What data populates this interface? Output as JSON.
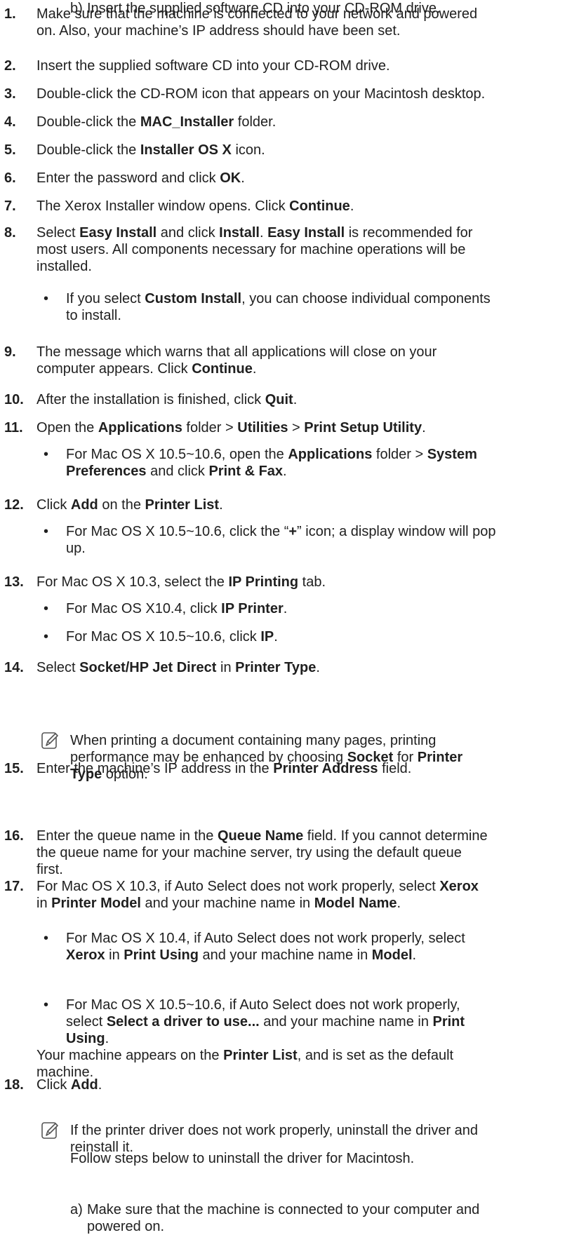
{
  "steps": [
    {
      "num": "1.",
      "lines": [
        [
          {
            "t": "Make sure that the machine is connected to your network and powered"
          }
        ],
        [
          {
            "t": "on. Also, your machine’s IP address should have been set."
          }
        ]
      ]
    },
    {
      "num": "2.",
      "lines": [
        [
          {
            "t": "Insert the supplied software CD into your CD-ROM drive."
          }
        ]
      ]
    },
    {
      "num": "3.",
      "lines": [
        [
          {
            "t": "Double-click the CD-ROM icon that appears on your Macintosh desktop."
          }
        ]
      ]
    },
    {
      "num": "4.",
      "lines": [
        [
          {
            "t": "Double-click the "
          },
          {
            "t": "MAC_Installer",
            "b": true
          },
          {
            "t": " folder."
          }
        ]
      ]
    },
    {
      "num": "5.",
      "lines": [
        [
          {
            "t": "Double-click the "
          },
          {
            "t": "Installer OS X",
            "b": true
          },
          {
            "t": " icon."
          }
        ]
      ]
    },
    {
      "num": "6.",
      "lines": [
        [
          {
            "t": "Enter the password and click "
          },
          {
            "t": "OK",
            "b": true
          },
          {
            "t": "."
          }
        ]
      ]
    },
    {
      "num": "7.",
      "lines": [
        [
          {
            "t": "The Xerox Installer window opens. Click "
          },
          {
            "t": "Continue",
            "b": true
          },
          {
            "t": "."
          }
        ]
      ]
    },
    {
      "num": "8.",
      "lines": [
        [
          {
            "t": "Select "
          },
          {
            "t": "Easy Install",
            "b": true
          },
          {
            "t": " and click "
          },
          {
            "t": "Install",
            "b": true
          },
          {
            "t": ". "
          },
          {
            "t": "Easy Install",
            "b": true
          },
          {
            "t": " is recommended for"
          }
        ],
        [
          {
            "t": "most users. All components necessary for machine operations will be"
          }
        ],
        [
          {
            "t": "installed."
          }
        ]
      ]
    },
    {
      "bullet": "•",
      "lines": [
        [
          {
            "t": "If you select "
          },
          {
            "t": "Custom Install",
            "b": true
          },
          {
            "t": ", you can choose individual components"
          }
        ],
        [
          {
            "t": "to install."
          }
        ]
      ]
    },
    {
      "num": "9.",
      "lines": [
        [
          {
            "t": "The message which warns that all applications will close on your"
          }
        ],
        [
          {
            "t": "computer appears. Click "
          },
          {
            "t": "Continue",
            "b": true
          },
          {
            "t": "."
          }
        ]
      ]
    },
    {
      "num": "10.",
      "lines": [
        [
          {
            "t": "After the installation is finished, click "
          },
          {
            "t": "Quit",
            "b": true
          },
          {
            "t": "."
          }
        ]
      ]
    },
    {
      "num": "11.",
      "lines": [
        [
          {
            "t": "Open the "
          },
          {
            "t": "Applications",
            "b": true
          },
          {
            "t": " folder > "
          },
          {
            "t": "Utilities",
            "b": true
          },
          {
            "t": " > "
          },
          {
            "t": "Print Setup Utility",
            "b": true
          },
          {
            "t": "."
          }
        ]
      ]
    },
    {
      "bullet": "•",
      "lines": [
        [
          {
            "t": "For Mac OS X 10.5~10.6, open the "
          },
          {
            "t": "Applications",
            "b": true
          },
          {
            "t": " folder > "
          },
          {
            "t": "System",
            "b": true
          }
        ],
        [
          {
            "t": "Preferences",
            "b": true
          },
          {
            "t": " and click "
          },
          {
            "t": "Print & Fax",
            "b": true
          },
          {
            "t": "."
          }
        ]
      ]
    },
    {
      "num": "12.",
      "lines": [
        [
          {
            "t": "Click "
          },
          {
            "t": "Add",
            "b": true
          },
          {
            "t": " on the "
          },
          {
            "t": "Printer List",
            "b": true
          },
          {
            "t": "."
          }
        ]
      ]
    },
    {
      "bullet": "•",
      "lines": [
        [
          {
            "t": "For Mac OS X 10.5~10.6, click the “"
          },
          {
            "t": "+",
            "b": true
          },
          {
            "t": "” icon; a display window will pop"
          }
        ],
        [
          {
            "t": "up."
          }
        ]
      ]
    },
    {
      "num": "13.",
      "lines": [
        [
          {
            "t": "For Mac OS X 10.3, select the "
          },
          {
            "t": "IP Printing",
            "b": true
          },
          {
            "t": " tab."
          }
        ]
      ]
    },
    {
      "bullet": "•",
      "lines": [
        [
          {
            "t": "For Mac OS X10.4, click "
          },
          {
            "t": "IP Printer",
            "b": true
          },
          {
            "t": "."
          }
        ]
      ]
    },
    {
      "bullet": "•",
      "lines": [
        [
          {
            "t": "For Mac OS X 10.5~10.6, click "
          },
          {
            "t": "IP",
            "b": true
          },
          {
            "t": "."
          }
        ]
      ]
    },
    {
      "num": "14.",
      "lines": [
        [
          {
            "t": "Select "
          },
          {
            "t": "Socket/HP Jet Direct",
            "b": true
          },
          {
            "t": " in "
          },
          {
            "t": "Printer Type",
            "b": true
          },
          {
            "t": "."
          }
        ]
      ]
    },
    {
      "note": true,
      "lines": [
        [
          {
            "t": "When printing a document containing many pages, printing"
          }
        ],
        [
          {
            "t": "performance may be enhanced by choosing "
          },
          {
            "t": "Socket",
            "b": true
          },
          {
            "t": " for "
          },
          {
            "t": "Printer",
            "b": true
          }
        ],
        [
          {
            "t": "Type",
            "b": true
          },
          {
            "t": " option."
          }
        ]
      ]
    },
    {
      "num": "15.",
      "lines": [
        [
          {
            "t": "Enter the machine’s IP address in the "
          },
          {
            "t": "Printer Address",
            "b": true
          },
          {
            "t": " field."
          }
        ]
      ]
    },
    {
      "num": "16.",
      "lines": [
        [
          {
            "t": "Enter the queue name in the "
          },
          {
            "t": "Queue Name",
            "b": true
          },
          {
            "t": " field. If you cannot determine"
          }
        ],
        [
          {
            "t": "the queue name for your machine server, try using the default queue"
          }
        ],
        [
          {
            "t": "first."
          }
        ]
      ]
    },
    {
      "num": "17.",
      "lines": [
        [
          {
            "t": "For Mac OS X 10.3, if Auto Select does not work properly, select "
          },
          {
            "t": "Xerox",
            "b": true
          }
        ],
        [
          {
            "t": "in "
          },
          {
            "t": "Printer Model",
            "b": true
          },
          {
            "t": " and your machine name in "
          },
          {
            "t": "Model Name",
            "b": true
          },
          {
            "t": "."
          }
        ]
      ]
    },
    {
      "bullet": "•",
      "lines": [
        [
          {
            "t": "For Mac OS X 10.4, if Auto Select does not work properly, select"
          }
        ],
        [
          {
            "t": "Xerox",
            "b": true
          },
          {
            "t": " in "
          },
          {
            "t": "Print Using",
            "b": true
          },
          {
            "t": " and your machine name in "
          },
          {
            "t": "Model",
            "b": true
          },
          {
            "t": "."
          }
        ]
      ]
    },
    {
      "bullet": "•",
      "lines": [
        [
          {
            "t": "For Mac OS X 10.5~10.6, if Auto Select does not work properly,"
          }
        ],
        [
          {
            "t": "select "
          },
          {
            "t": "Select a driver to use...",
            "b": true
          },
          {
            "t": " and your machine name in "
          },
          {
            "t": "Print",
            "b": true
          }
        ],
        [
          {
            "t": "Using",
            "b": true
          },
          {
            "t": "."
          }
        ]
      ]
    },
    {
      "cont": true,
      "lines": [
        [
          {
            "t": "Your machine appears on the "
          },
          {
            "t": "Printer List",
            "b": true
          },
          {
            "t": ", and is set as the default"
          }
        ],
        [
          {
            "t": "machine."
          }
        ]
      ]
    },
    {
      "num": "18.",
      "lines": [
        [
          {
            "t": "Click "
          },
          {
            "t": "Add",
            "b": true
          },
          {
            "t": "."
          }
        ]
      ]
    },
    {
      "note": true,
      "lines": [
        [
          {
            "t": "If the printer driver does not work properly, uninstall the driver and"
          }
        ],
        [
          {
            "t": "reinstall it."
          }
        ]
      ]
    },
    {
      "note_text": true,
      "lines": [
        [
          {
            "t": "Follow steps below to uninstall the driver for Macintosh."
          }
        ]
      ]
    },
    {
      "letter": "a)",
      "lines": [
        [
          {
            "t": "Make sure that the machine is connected to your computer and"
          }
        ],
        [
          {
            "t": "powered on."
          }
        ]
      ]
    },
    {
      "letter": "b)",
      "lines": [
        [
          {
            "t": "Insert the supplied software CD into your CD-ROM drive."
          }
        ]
      ]
    }
  ]
}
